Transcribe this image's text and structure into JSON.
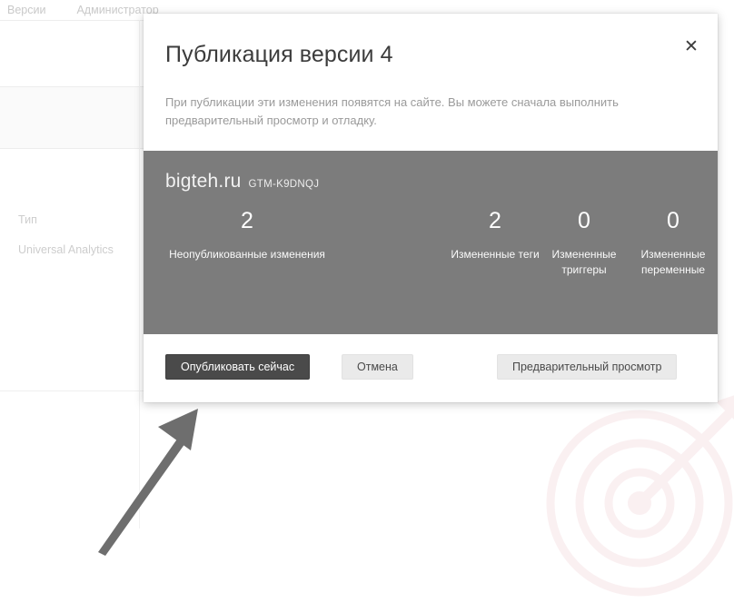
{
  "background": {
    "tabs": [
      {
        "label": "Версии"
      },
      {
        "label": "Администратор"
      }
    ],
    "fields": {
      "type_label": "Тип",
      "type_value": "Universal Analytics"
    }
  },
  "dialog": {
    "title": "Публикация версии 4",
    "description": "При публикации эти изменения появятся на сайте. Вы можете сначала выполнить предварительный просмотр и отладку.",
    "close_icon": "close-icon",
    "close_glyph": "✕",
    "panel": {
      "site_name": "bigteh.ru",
      "container_id": "GTM-K9DNQJ",
      "background_color": "#7c7c7c",
      "stats": [
        {
          "value": "2",
          "label": "Неопубликованные изменения"
        },
        {
          "value": "2",
          "label": "Измененные теги"
        },
        {
          "value": "0",
          "label": "Измененные триггеры"
        },
        {
          "value": "0",
          "label": "Измененные переменные"
        }
      ]
    },
    "actions": {
      "publish_label": "Опубликовать сейчас",
      "cancel_label": "Отмена",
      "preview_label": "Предварительный просмотр",
      "publish_color": "#4a4a4a",
      "secondary_color": "#eaeaea"
    }
  },
  "annotation": {
    "arrow_color": "#6e6e6e",
    "arrow_name": "callout-arrow"
  },
  "watermark": {
    "color": "#f7e4e6",
    "name": "target-watermark"
  }
}
